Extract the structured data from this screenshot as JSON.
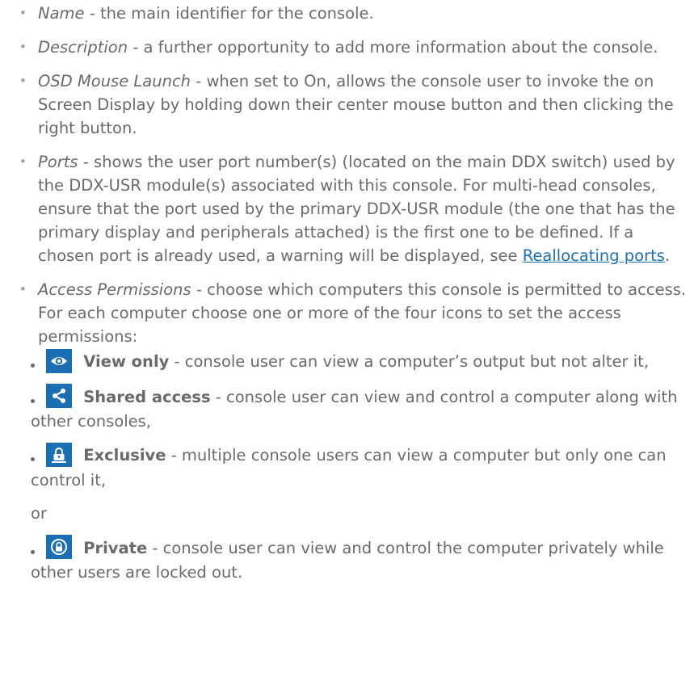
{
  "bullets": [
    {
      "term": "Name",
      "text": " - the main identifier for the console."
    },
    {
      "term": "Description",
      "text": " - a further opportunity to add more information about the console."
    },
    {
      "term": "OSD Mouse Launch",
      "text": " - when set to On, allows the console user to invoke the on Screen Display by holding down their center mouse button and then clicking the right button."
    },
    {
      "term": "Ports",
      "text": " - shows the user port number(s) (located on the main DDX switch) used by the DDX-USR module(s) associated with this console. For multi-head consoles, ensure that the port used by the primary DDX-USR module (the one that has the primary display and peripherals attached) is the first one to be defined. If a chosen port is already used, a warning will be displayed, see ",
      "link": "Reallocating ports",
      "after": "."
    },
    {
      "term": "Access Permissions",
      "text": " - choose which computers this console is permitted to access. For each computer choose one or more of the four icons to set the access permissions:"
    }
  ],
  "permissions": [
    {
      "icon": "eye-icon",
      "label": "View only",
      "text": " - console user can view a computer’s output but not alter it,"
    },
    {
      "icon": "share-icon",
      "label": "Shared access",
      "text": " - console user can view and control a computer along with other consoles,"
    },
    {
      "icon": "exclusive-lock-icon",
      "label": "Exclusive",
      "text": " - multiple console users can view a computer but only one can control it,"
    },
    {
      "icon": "private-lock-icon",
      "label": "Private",
      "text": " - console user can view and control the computer privately while other users are locked out."
    }
  ],
  "or_text": "or",
  "colors": {
    "body_text": "#6a6a6a",
    "link": "#1f6fb5",
    "icon_bg": "#1a6fb4"
  }
}
